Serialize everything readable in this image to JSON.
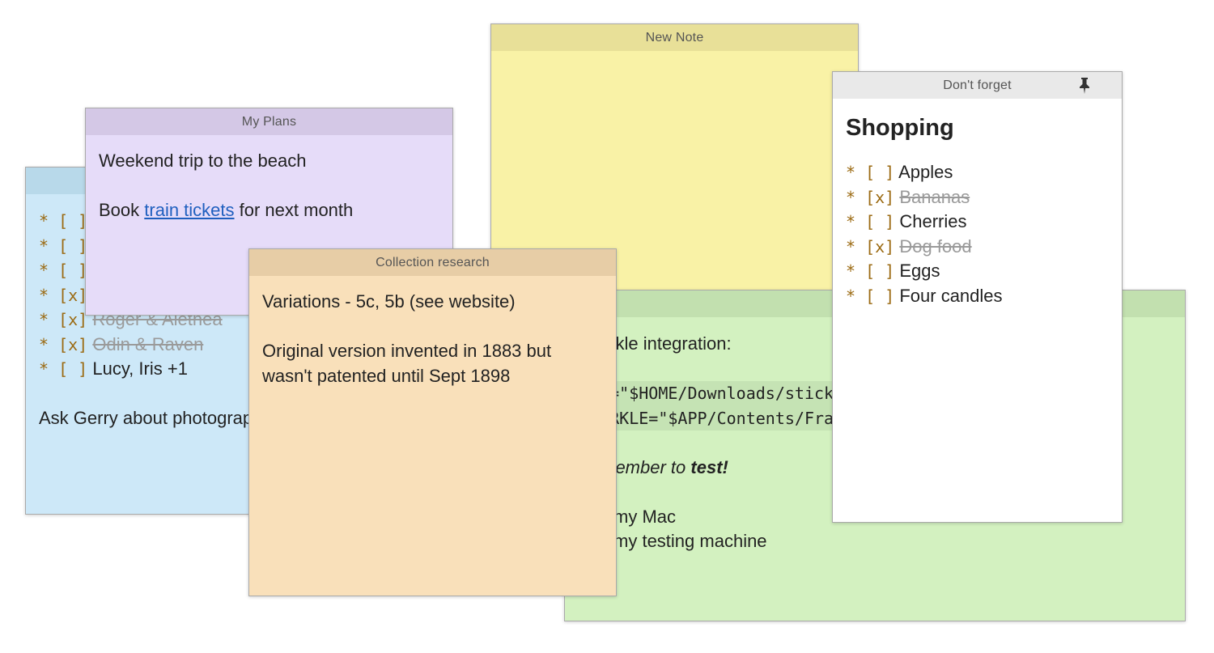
{
  "notes": {
    "blue": {
      "title": "",
      "items": [
        {
          "bullet": "* [ ]",
          "text": "",
          "done": false
        },
        {
          "bullet": "* [ ]",
          "text": "",
          "done": false
        },
        {
          "bullet": "* [ ]",
          "text": "",
          "done": false
        },
        {
          "bullet": "* [x]",
          "text": "",
          "done": true
        },
        {
          "bullet": "* [x]",
          "text": "Roger & Alethea",
          "done": true
        },
        {
          "bullet": "* [x]",
          "text": "Odin & Raven",
          "done": true
        },
        {
          "bullet": "* [ ]",
          "text": "Lucy, Iris +1",
          "done": false
        }
      ],
      "footer": "Ask Gerry about photographer"
    },
    "purple": {
      "title": "My Plans",
      "line1": "Weekend trip to the beach",
      "line2_prefix": "Book ",
      "line2_link": "train tickets",
      "line2_suffix": " for next month"
    },
    "yellow": {
      "title": "New Note"
    },
    "orange": {
      "title": "Collection research",
      "line1": "Variations - 5c, 5b (see website)",
      "line2": "Original version invented in 1883 but",
      "line3": "wasn't patented until Sept 1898"
    },
    "green": {
      "title": "",
      "line1": "Sparkle integration:",
      "code1": "APP=\"$HOME/Downloads/stickies.app\"",
      "code2": "SPARKLE=\"$APP/Contents/Frameworks/Sparkle.framework\"",
      "remember_prefix": "Remember to ",
      "remember_bold": "test!",
      "item1": "- on my Mac",
      "item2": "- on my testing machine"
    },
    "white": {
      "title": "Don't forget",
      "heading": "Shopping",
      "items": [
        {
          "bullet": "* [ ]",
          "text": "Apples",
          "done": false
        },
        {
          "bullet": "* [x]",
          "text": "Bananas",
          "done": true
        },
        {
          "bullet": "* [ ]",
          "text": "Cherries",
          "done": false
        },
        {
          "bullet": "* [x]",
          "text": "Dog food",
          "done": true
        },
        {
          "bullet": "* [ ]",
          "text": "Eggs",
          "done": false
        },
        {
          "bullet": "* [ ]",
          "text": "Four candles",
          "done": false
        }
      ]
    }
  },
  "colors": {
    "blue_body": "#cde8f8",
    "blue_title": "#b8d9ea",
    "purple_body": "#e6dcf9",
    "purple_title": "#d4c8e6",
    "yellow_body": "#f9f2a6",
    "yellow_title": "#e8e098",
    "orange_body": "#f9e0ba",
    "orange_title": "#e7cda6",
    "green_body": "#d3f1c0",
    "green_title": "#c2e0af",
    "white_body": "#ffffff",
    "white_title": "#e9e9e9"
  }
}
